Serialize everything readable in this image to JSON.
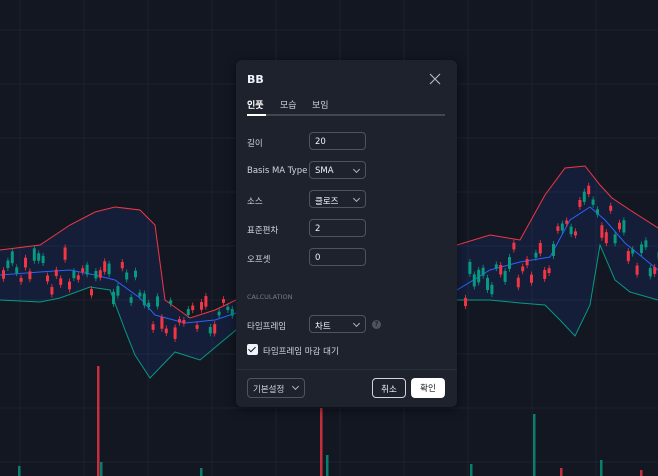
{
  "dialog": {
    "title": "BB",
    "tabs": [
      {
        "label": "인풋",
        "active": true
      },
      {
        "label": "모습",
        "active": false
      },
      {
        "label": "보임",
        "active": false
      }
    ],
    "fields": {
      "length": {
        "label": "길이",
        "value": "20"
      },
      "basis_ma_type": {
        "label": "Basis MA Type",
        "value": "SMA"
      },
      "source": {
        "label": "소스",
        "value": "클로즈"
      },
      "stddev": {
        "label": "표준편차",
        "value": "2"
      },
      "offset": {
        "label": "오프셋",
        "value": "0"
      }
    },
    "calculation_section": "CALCULATION",
    "timeframe": {
      "label": "타임프레임",
      "value": "차트",
      "help_glyph": "?"
    },
    "wait_close": {
      "label": "타임프레임 마감 대기",
      "checked": true
    },
    "footer": {
      "defaults_label": "기본설정",
      "cancel_label": "취소",
      "ok_label": "확인"
    }
  },
  "colors": {
    "background": "#131722",
    "dialog": "#1e222d",
    "upper_band": "#f23645",
    "basis": "#2962ff",
    "lower_band": "#089981",
    "candle_up": "#089981",
    "candle_down": "#f23645"
  },
  "icons": {
    "close": "close-icon",
    "chevron": "chevron-down-icon",
    "check": "check-icon",
    "help": "question-icon"
  }
}
